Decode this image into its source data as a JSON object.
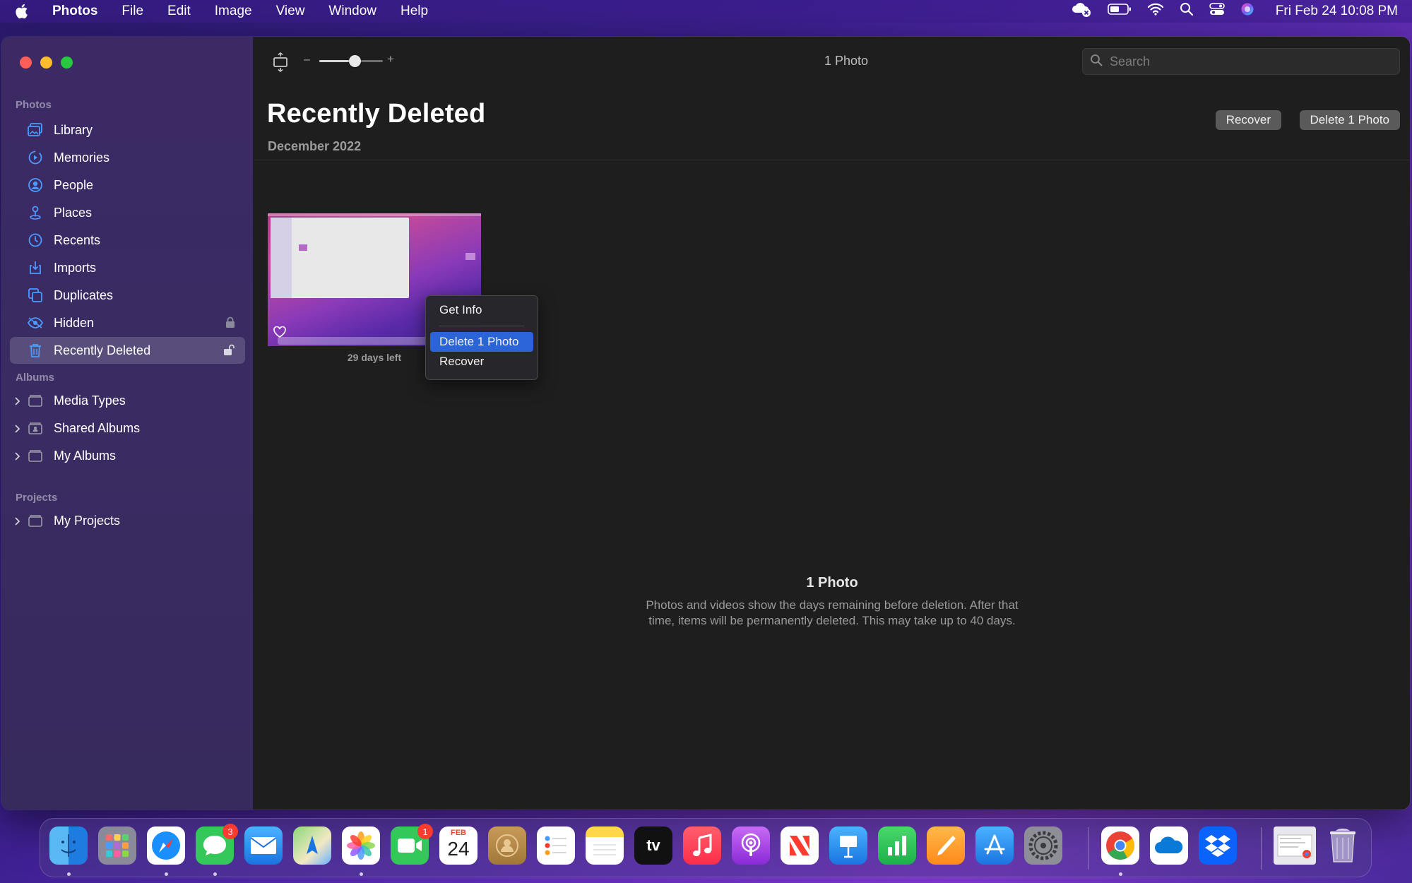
{
  "menubar": {
    "app_name": "Photos",
    "items": [
      "File",
      "Edit",
      "Image",
      "View",
      "Window",
      "Help"
    ],
    "clock": "Fri Feb 24  10:08 PM"
  },
  "sidebar": {
    "photos_header": "Photos",
    "photos_items": [
      {
        "label": "Library",
        "icon": "library-icon"
      },
      {
        "label": "Memories",
        "icon": "memories-icon"
      },
      {
        "label": "People",
        "icon": "people-icon"
      },
      {
        "label": "Places",
        "icon": "places-icon"
      },
      {
        "label": "Recents",
        "icon": "clock-icon"
      },
      {
        "label": "Imports",
        "icon": "import-icon"
      },
      {
        "label": "Duplicates",
        "icon": "duplicates-icon"
      },
      {
        "label": "Hidden",
        "icon": "eye-icon"
      },
      {
        "label": "Recently Deleted",
        "icon": "trash-icon"
      }
    ],
    "albums_header": "Albums",
    "album_items": [
      "Media Types",
      "Shared Albums",
      "My Albums"
    ],
    "projects_header": "Projects",
    "project_items": [
      "My Projects"
    ]
  },
  "toolbar": {
    "photo_count": "1 Photo",
    "search_placeholder": "Search",
    "zoom_level": 0.55
  },
  "content": {
    "title": "Recently Deleted",
    "subtitle": "December 2022",
    "recover_button": "Recover",
    "delete_button": "Delete 1 Photo",
    "thumbnail_caption": "29 days left",
    "footer_title": "1 Photo",
    "footer_text": "Photos and videos show the days remaining before deletion. After that time, items will be permanently deleted. This may take up to 40 days."
  },
  "context_menu": {
    "items": [
      "Get Info",
      "Delete 1 Photo",
      "Recover"
    ],
    "highlighted": "Delete 1 Photo"
  },
  "dock": {
    "apps": [
      "Finder",
      "Launchpad",
      "Safari",
      "Messages",
      "Mail",
      "Maps",
      "Photos",
      "FaceTime",
      "Calendar",
      "Contacts",
      "Reminders",
      "Notes",
      "TV",
      "Music",
      "Podcasts",
      "News",
      "Keynote",
      "Numbers",
      "Pages",
      "App Store",
      "System Settings",
      "Chrome",
      "OneDrive",
      "Dropbox",
      "Downloads",
      "Trash"
    ],
    "messages_badge": "3",
    "facetime_badge": "1",
    "calendar_month": "FEB",
    "calendar_day": "24",
    "tv_label": "tv"
  },
  "colors": {
    "accent": "#2a64d6",
    "sidebar_icon": "#4a9bff",
    "window_bg": "#1e1e1e"
  }
}
